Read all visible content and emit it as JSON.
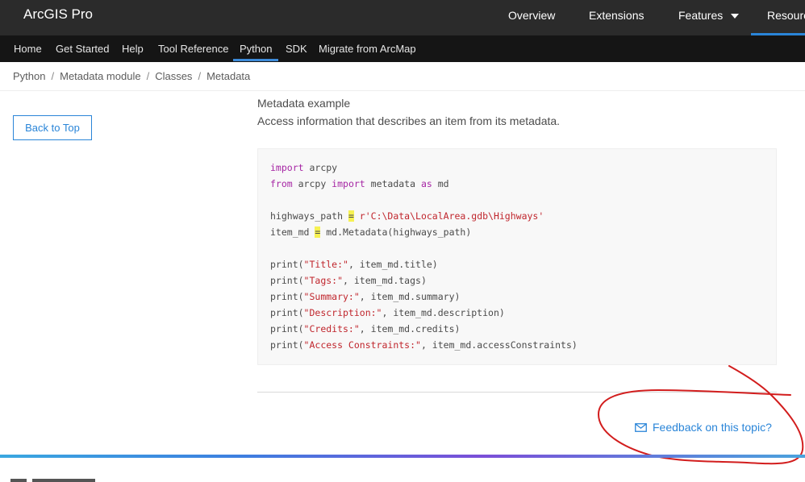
{
  "header": {
    "brand": "ArcGIS Pro",
    "nav": [
      {
        "label": "Overview"
      },
      {
        "label": "Extensions"
      },
      {
        "label": "Features"
      },
      {
        "label": "Resourc"
      }
    ]
  },
  "subnav": {
    "items": [
      {
        "label": "Home"
      },
      {
        "label": "Get Started"
      },
      {
        "label": "Help"
      },
      {
        "label": "Tool Reference"
      },
      {
        "label": "Python"
      },
      {
        "label": "SDK"
      },
      {
        "label": "Migrate from ArcMap"
      }
    ],
    "active": "Python"
  },
  "breadcrumb": {
    "items": [
      "Python",
      "Metadata module",
      "Classes",
      "Metadata"
    ],
    "separator": "/"
  },
  "sidebar": {
    "back_to_top": "Back to Top"
  },
  "example": {
    "title": "Metadata example",
    "description": "Access information that describes an item from its metadata."
  },
  "code": {
    "l1_kw": "import",
    "l1_rest": " arcpy",
    "l2_kw1": "from",
    "l2_mid1": " arcpy ",
    "l2_kw2": "import",
    "l2_mid2": " metadata ",
    "l2_kw3": "as",
    "l2_rest": " md",
    "l3_a": "highways_path ",
    "l3_eq": "=",
    "l3_str": " r'C:\\Data\\LocalArea.gdb\\Highways'",
    "l4_a": "item_md ",
    "l4_eq": "=",
    "l4_rest": " md.Metadata(highways_path)",
    "p1_a": "print(",
    "p1_s": "\"Title:\"",
    "p1_b": ", item_md.title)",
    "p2_a": "print(",
    "p2_s": "\"Tags:\"",
    "p2_b": ", item_md.tags)",
    "p3_a": "print(",
    "p3_s": "\"Summary:\"",
    "p3_b": ", item_md.summary)",
    "p4_a": "print(",
    "p4_s": "\"Description:\"",
    "p4_b": ", item_md.description)",
    "p5_a": "print(",
    "p5_s": "\"Credits:\"",
    "p5_b": ", item_md.credits)",
    "p6_a": "print(",
    "p6_s": "\"Access Constraints:\"",
    "p6_b": ", item_md.accessConstraints)"
  },
  "feedback": {
    "label": "Feedback on this topic?"
  },
  "colors": {
    "accent": "#2a85d8",
    "header_bg": "#2b2b2b",
    "subnav_bg": "#151515",
    "annotation": "#d21d1d"
  },
  "icons": {
    "feedback": "envelope-icon",
    "dropdown": "caret-down-icon"
  }
}
